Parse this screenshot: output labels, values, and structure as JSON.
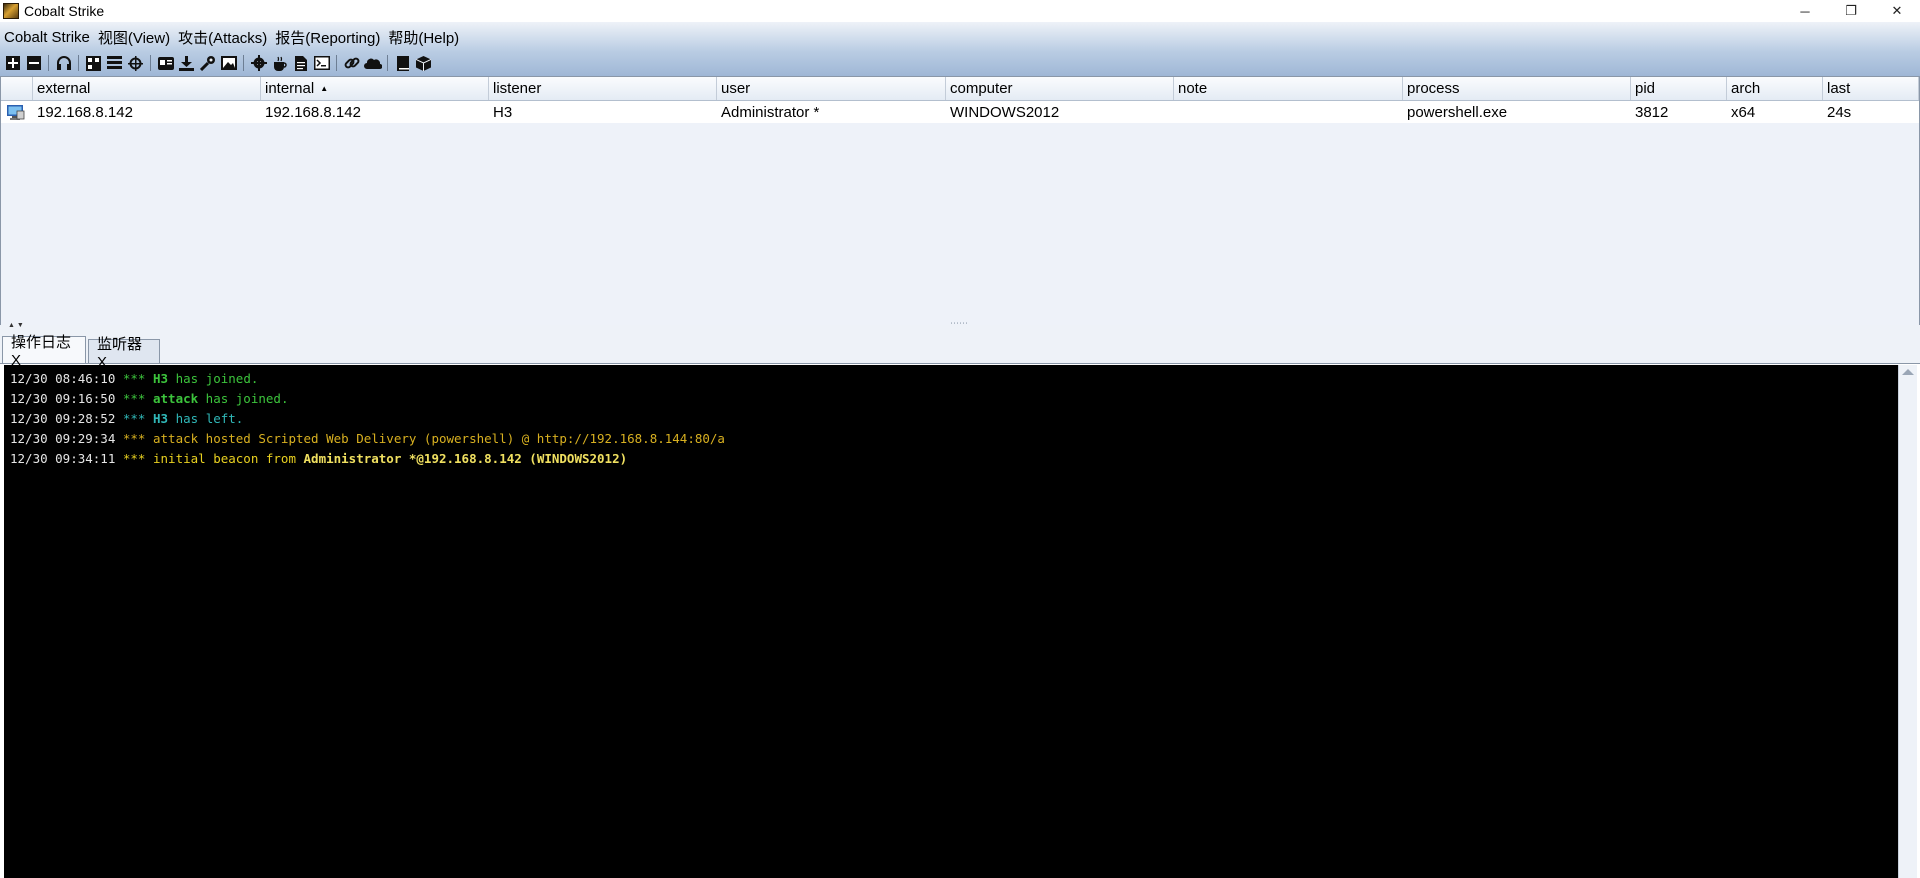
{
  "window": {
    "title": "Cobalt Strike",
    "minimize": "─",
    "restore": "❐",
    "close": "✕"
  },
  "menu": [
    {
      "label": "Cobalt Strike"
    },
    {
      "label": "视图(View)"
    },
    {
      "label": "攻击(Attacks)"
    },
    {
      "label": "报告(Reporting)"
    },
    {
      "label": "帮助(Help)"
    }
  ],
  "toolbar": [
    {
      "name": "new-connection-icon"
    },
    {
      "name": "disconnect-icon"
    },
    {
      "sep": true
    },
    {
      "name": "listeners-headphones-icon"
    },
    {
      "sep": true
    },
    {
      "name": "pivot-graph-icon"
    },
    {
      "name": "session-table-icon"
    },
    {
      "name": "targets-crosshair-icon"
    },
    {
      "sep": true
    },
    {
      "name": "credentials-icon"
    },
    {
      "name": "downloads-icon"
    },
    {
      "name": "keystrokes-key-icon"
    },
    {
      "name": "screenshots-icon"
    },
    {
      "sep": true
    },
    {
      "name": "generate-payload-gear-icon"
    },
    {
      "name": "java-applet-coffee-icon"
    },
    {
      "name": "office-macro-icon"
    },
    {
      "name": "powershell-web-delivery-icon"
    },
    {
      "sep": true
    },
    {
      "name": "host-file-link-icon"
    },
    {
      "name": "web-log-cloud-icon"
    },
    {
      "sep": true
    },
    {
      "name": "manual-book-icon"
    },
    {
      "name": "active-sessions-cube-icon"
    }
  ],
  "table": {
    "columns": [
      {
        "key": "icon",
        "label": ""
      },
      {
        "key": "external",
        "label": "external"
      },
      {
        "key": "internal",
        "label": "internal",
        "sort": "▲"
      },
      {
        "key": "listener",
        "label": "listener"
      },
      {
        "key": "user",
        "label": "user"
      },
      {
        "key": "computer",
        "label": "computer"
      },
      {
        "key": "note",
        "label": "note"
      },
      {
        "key": "process",
        "label": "process"
      },
      {
        "key": "pid",
        "label": "pid"
      },
      {
        "key": "arch",
        "label": "arch"
      },
      {
        "key": "last",
        "label": "last"
      }
    ],
    "rows": [
      {
        "icon": "monitor-icon",
        "external": "192.168.8.142",
        "internal": "192.168.8.142",
        "listener": "H3",
        "user": "Administrator *",
        "computer": "WINDOWS2012",
        "note": "",
        "process": "powershell.exe",
        "pid": "3812",
        "arch": "x64",
        "last": "24s"
      }
    ]
  },
  "splitter": {
    "arrows": "▲ ▼",
    "grip": "⋯⋯"
  },
  "tabs": [
    {
      "label": "操作日志X",
      "active": true
    },
    {
      "label": "监听器X",
      "active": false
    }
  ],
  "log": [
    {
      "time": "12/30 08:46:10",
      "parts": [
        {
          "t": " *** ",
          "c": "#3cc43c",
          "b": false
        },
        {
          "t": "H3",
          "c": "#3cc43c",
          "b": true
        },
        {
          "t": " has joined.",
          "c": "#3cc43c",
          "b": false
        }
      ]
    },
    {
      "time": "12/30 09:16:50",
      "parts": [
        {
          "t": " *** ",
          "c": "#3cc43c",
          "b": false
        },
        {
          "t": "attack",
          "c": "#3cc43c",
          "b": true
        },
        {
          "t": " has joined.",
          "c": "#3cc43c",
          "b": false
        }
      ]
    },
    {
      "time": "12/30 09:28:52",
      "parts": [
        {
          "t": " *** ",
          "c": "#30b8b8",
          "b": false
        },
        {
          "t": "H3",
          "c": "#30b8b8",
          "b": true
        },
        {
          "t": " has left.",
          "c": "#30b8b8",
          "b": false
        }
      ]
    },
    {
      "time": "12/30 09:29:34",
      "parts": [
        {
          "t": " *** ",
          "c": "#d8b020",
          "b": false
        },
        {
          "t": "attack hosted Scripted Web Delivery (powershell) @ http://192.168.8.144:80/a",
          "c": "#d8b020",
          "b": false
        }
      ]
    },
    {
      "time": "12/30 09:34:11",
      "parts": [
        {
          "t": " *** ",
          "c": "#e8d020",
          "b": false
        },
        {
          "t": "initial beacon from ",
          "c": "#e8d020",
          "b": false
        },
        {
          "t": "Administrator *",
          "c": "#f0e060",
          "b": true
        },
        {
          "t": "@192.168.8.142 (WINDOWS2012)",
          "c": "#f0e060",
          "b": true
        }
      ]
    }
  ]
}
